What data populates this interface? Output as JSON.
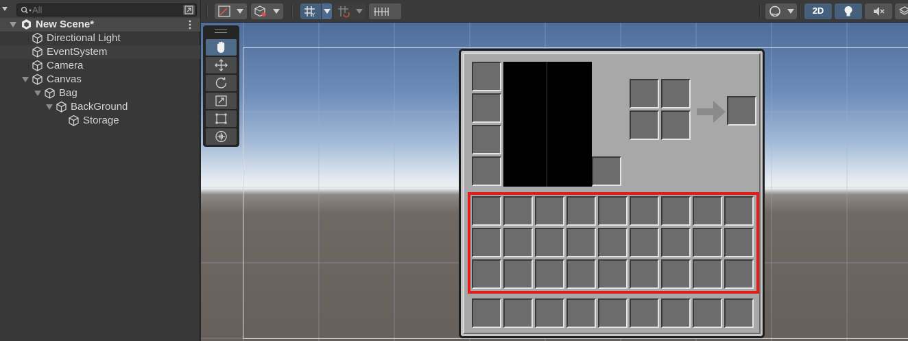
{
  "hierarchy": {
    "search": {
      "placeholder": "All",
      "value": ""
    },
    "menu_icon": "caret-down-icon",
    "search_icon": "search-icon",
    "expand_icon": "expand-window-icon",
    "scene": {
      "label": "New Scene*",
      "icon": "unity-logo-icon",
      "menu_icon": "kebab-menu-icon"
    },
    "items": [
      {
        "label": "Directional Light",
        "icon": "gameobject-cube-icon"
      },
      {
        "label": "EventSystem",
        "icon": "gameobject-cube-icon"
      },
      {
        "label": "Camera",
        "icon": "gameobject-cube-icon"
      },
      {
        "label": "Canvas",
        "icon": "gameobject-cube-icon",
        "expanded": true
      },
      {
        "label": "Bag",
        "icon": "gameobject-cube-icon",
        "expanded": true
      },
      {
        "label": "BackGround",
        "icon": "gameobject-cube-icon",
        "expanded": true
      },
      {
        "label": "Storage",
        "icon": "gameobject-cube-icon"
      }
    ]
  },
  "scene_toolbar": {
    "tools_left": [
      "draw-mode-icon",
      "gizmo-cube-icon",
      "grid-snap-icon",
      "increment-snap-icon",
      "snap-settings-icon"
    ],
    "mode_2d_label": "2D",
    "tools_right": [
      "gizmos-sphere-icon",
      "lighting-bulb-icon",
      "audio-mute-icon",
      "scene-layers-icon"
    ],
    "accent_color": "#46607c"
  },
  "tools_palette": {
    "tools": [
      "hand-tool-icon",
      "move-tool-icon",
      "rotate-tool-icon",
      "scale-tool-icon",
      "rect-tool-icon",
      "transform-tool-icon"
    ],
    "active": "hand-tool-icon"
  },
  "bag_ui": {
    "panel_color": "#c6c6c6",
    "slot_color": "#6c6c6c",
    "highlight_color": "#e31b1b",
    "equipment_slots": 4,
    "offhand_slots": 1,
    "crafting_grid": "2x2",
    "crafting_output_slots": 1,
    "storage_rows": 3,
    "storage_columns": 9,
    "hotbar_slots": 9,
    "highlighted": "Storage"
  }
}
